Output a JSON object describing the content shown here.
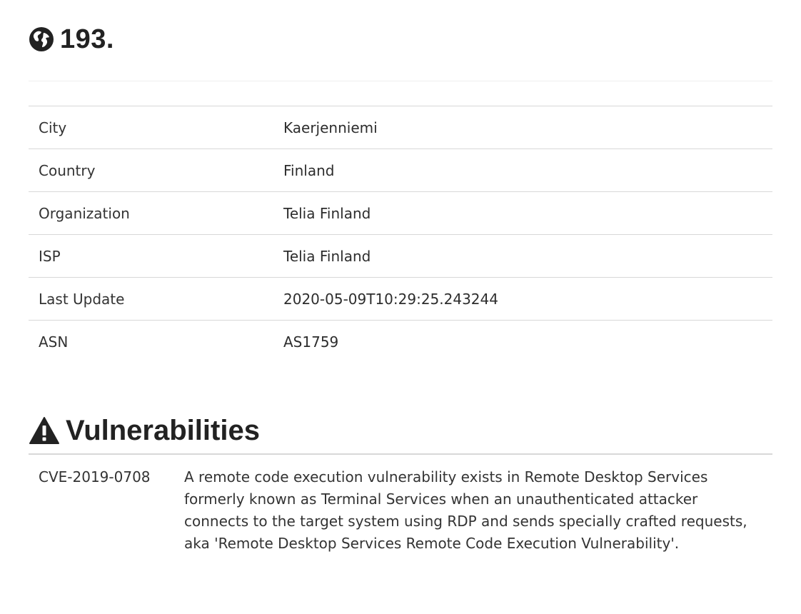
{
  "header": {
    "icon": "globe-icon",
    "ip_title": "193."
  },
  "info": [
    {
      "key": "City",
      "value": "Kaerjenniemi"
    },
    {
      "key": "Country",
      "value": "Finland"
    },
    {
      "key": "Organization",
      "value": "Telia Finland"
    },
    {
      "key": "ISP",
      "value": "Telia Finland"
    },
    {
      "key": "Last Update",
      "value": "2020-05-09T10:29:25.243244"
    },
    {
      "key": "ASN",
      "value": "AS1759"
    }
  ],
  "vulnerabilities": {
    "icon": "warning-icon",
    "title": "Vulnerabilities",
    "items": [
      {
        "id": "CVE-2019-0708",
        "summary": "A remote code execution vulnerability exists in Remote Desktop Services formerly known as Terminal Services when an unauthenticated attacker connects to the target system using RDP and sends specially crafted requests, aka 'Remote Desktop Services Remote Code Execution Vulnerability'."
      }
    ]
  }
}
